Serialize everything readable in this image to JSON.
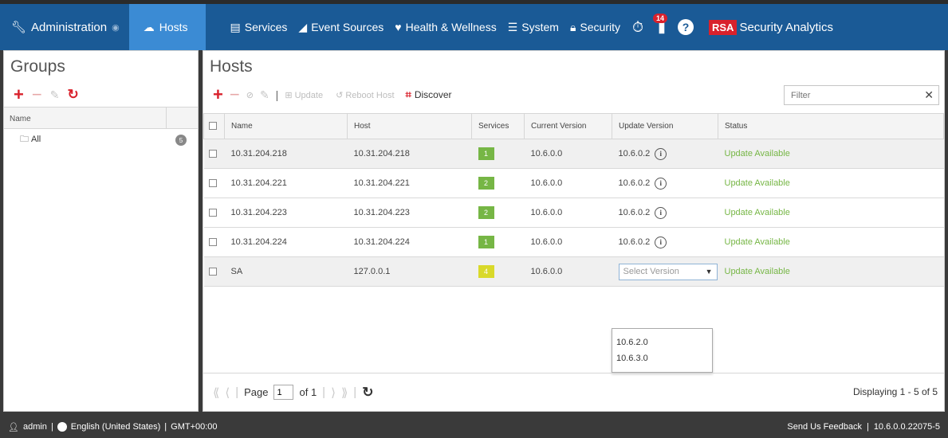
{
  "nav": {
    "admin_label": "Administration",
    "hosts_label": "Hosts",
    "services_label": "Services",
    "event_sources_label": "Event Sources",
    "health_label": "Health & Wellness",
    "system_label": "System",
    "security_label": "Security",
    "notification_count": "14",
    "rsa_logo": "RSA",
    "brand": "Security Analytics"
  },
  "groups": {
    "title": "Groups",
    "column_name": "Name",
    "items": [
      {
        "label": "All",
        "count": "5"
      }
    ]
  },
  "hosts": {
    "title": "Hosts",
    "toolbar": {
      "update_label": "Update",
      "reboot_label": "Reboot Host",
      "discover_label": "Discover",
      "filter_placeholder": "Filter"
    },
    "columns": [
      "Name",
      "Host",
      "Services",
      "Current Version",
      "Update Version",
      "Status"
    ],
    "rows": [
      {
        "name": "10.31.204.218",
        "host": "10.31.204.218",
        "services": "1",
        "current": "10.6.0.0",
        "update": "10.6.0.2",
        "status": "Update Available"
      },
      {
        "name": "10.31.204.221",
        "host": "10.31.204.221",
        "services": "2",
        "current": "10.6.0.0",
        "update": "10.6.0.2",
        "status": "Update Available"
      },
      {
        "name": "10.31.204.223",
        "host": "10.31.204.223",
        "services": "2",
        "current": "10.6.0.0",
        "update": "10.6.0.2",
        "status": "Update Available"
      },
      {
        "name": "10.31.204.224",
        "host": "10.31.204.224",
        "services": "1",
        "current": "10.6.0.0",
        "update": "10.6.0.2",
        "status": "Update Available"
      },
      {
        "name": "SA",
        "host": "127.0.0.1",
        "services": "4",
        "current": "10.6.0.0",
        "update_select_placeholder": "Select Version",
        "status": "Update Available"
      }
    ],
    "version_options": [
      "10.6.2.0",
      "10.6.3.0"
    ],
    "pager": {
      "page_label": "Page",
      "page_value": "1",
      "of_label": "of 1",
      "display_text": "Displaying 1 - 5 of 5"
    }
  },
  "footer": {
    "user": "admin",
    "language": "English (United States)",
    "timezone": "GMT+00:00",
    "feedback": "Send Us Feedback",
    "version": "10.6.0.0.22075-5"
  },
  "colors": {
    "nav_bg": "#1a5a96",
    "nav_active": "#3b8bd4",
    "services_green": "#76b645",
    "services_yellow": "#d9d92a",
    "status_green": "#76b645",
    "accent_red": "#d9212c"
  }
}
